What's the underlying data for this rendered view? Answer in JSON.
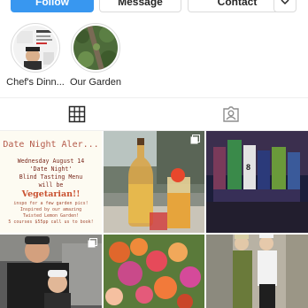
{
  "actions": {
    "follow_label": "Follow",
    "message_label": "Message",
    "contact_label": "Contact",
    "more_icon": "chevron-down-icon"
  },
  "highlights": [
    {
      "label": "Chef's Dinn..."
    },
    {
      "label": "Our Garden"
    }
  ],
  "tabs": [
    {
      "icon": "grid-icon",
      "active": true
    },
    {
      "icon": "tagged-icon",
      "active": false
    }
  ],
  "posts": {
    "flyer": {
      "title": "Date Night Aler...",
      "line1": "Wednesday August 14",
      "line2": "'Date Night'",
      "line3": "Blind Tasting Menu",
      "line4": "will be",
      "highlight": "Vegetarian!!",
      "line5": "inspo for a few garden pics!",
      "line6": "Inspired by our amazing",
      "line7": "Twisted Lemon Garden!",
      "line8": "5 courses $55pp call us to book!"
    }
  },
  "colors": {
    "accent": "#3897f0",
    "border": "#dbdbdb",
    "text": "#262626"
  }
}
